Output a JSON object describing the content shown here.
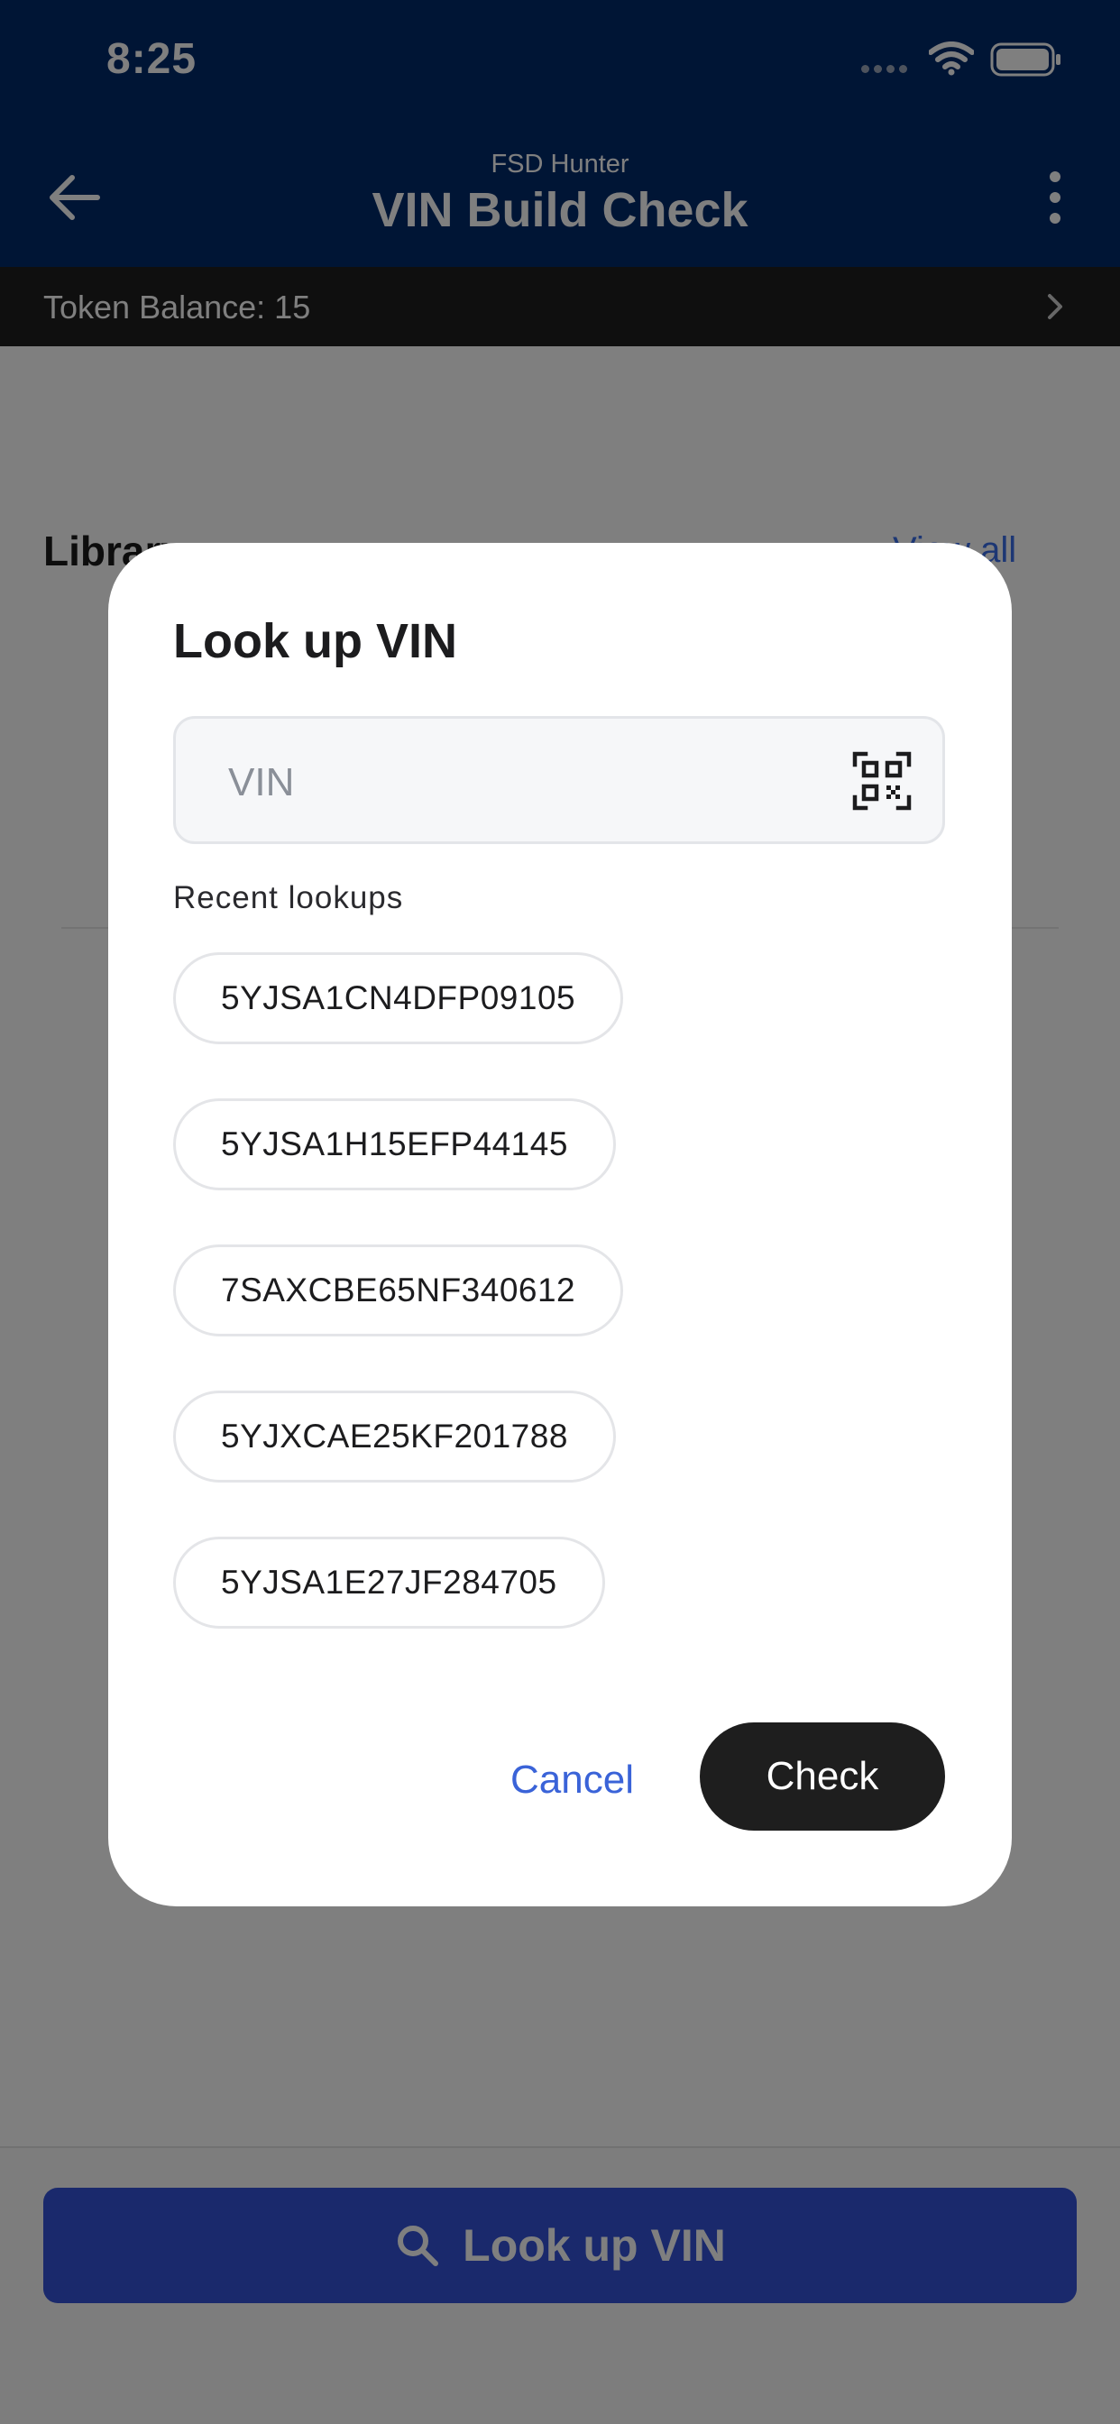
{
  "status_bar": {
    "time": "8:25"
  },
  "nav": {
    "subtitle": "FSD Hunter",
    "title": "VIN Build Check"
  },
  "token_bar": {
    "label": "Token Balance: 15"
  },
  "library": {
    "header": "Library",
    "view_all": "View all"
  },
  "bottom": {
    "lookup_button_label": "Look up VIN"
  },
  "dialog": {
    "title": "Look up VIN",
    "vin_placeholder": "VIN",
    "vin_value": "",
    "recent_label": "Recent lookups",
    "recent": [
      "5YJSA1CN4DFP09105",
      "5YJSA1H15EFP44145",
      "7SAXCBE65NF340612",
      "5YJXCAE25KF201788",
      "5YJSA1E27JF284705"
    ],
    "cancel_label": "Cancel",
    "check_label": "Check"
  },
  "colors": {
    "header_blue": "#002a6b",
    "primary_button": "#3553d8",
    "link_blue": "#3a63d8",
    "check_button": "#1e1e1e"
  },
  "icons": {
    "back": "arrow-left-icon",
    "more": "more-vertical-icon",
    "token_chevron": "chevron-right-icon",
    "scan": "qr-code-icon",
    "search": "search-icon"
  }
}
